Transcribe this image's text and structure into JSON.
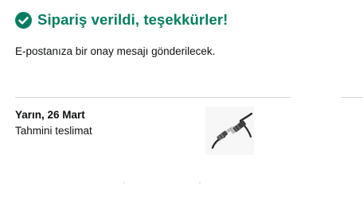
{
  "confirmation": {
    "icon": "check-circle-icon",
    "title": "Sipariş verildi, teşekkürler!",
    "subtitle": "E-postanıza bir onay mesajı gönderilecek."
  },
  "delivery": {
    "date": "Yarın, 26 Mart",
    "label": "Tahmini teslimat"
  },
  "product": {
    "image_icon": "audio-extension-cable-image"
  },
  "colors": {
    "success": "#067d62",
    "text": "#0f1111",
    "divider": "#d5d9d9"
  }
}
